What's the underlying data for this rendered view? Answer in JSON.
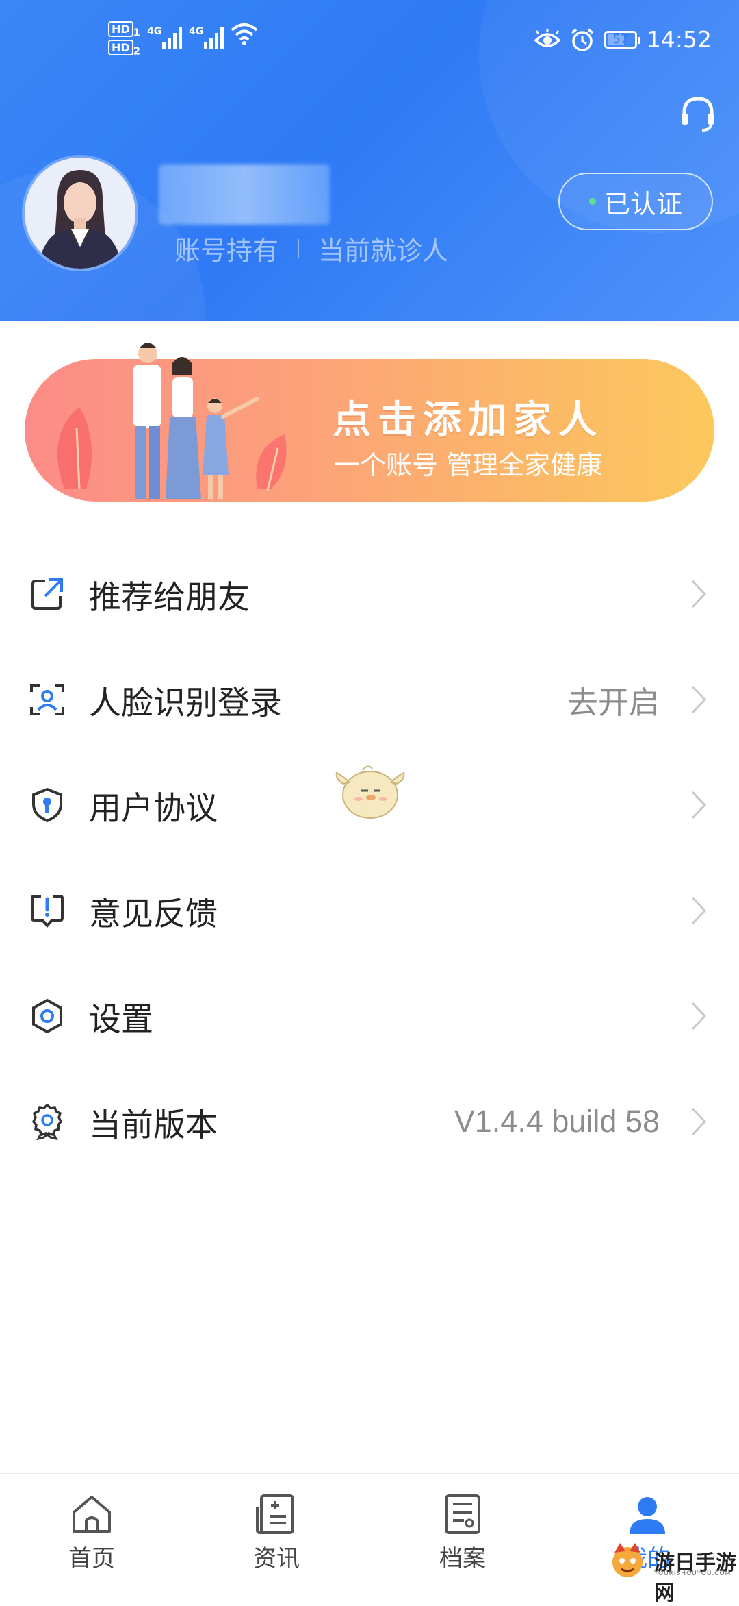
{
  "status_bar": {
    "hd1": "HD",
    "hd1_sub": "1",
    "hd2": "HD",
    "hd2_sub": "2",
    "net1": "4G",
    "net2": "4G",
    "battery": "57",
    "time": "14:52"
  },
  "profile": {
    "tag_holder": "账号持有",
    "tag_patient": "当前就诊人",
    "verified_label": "已认证"
  },
  "banner": {
    "title": "点击添加家人",
    "subtitle": "一个账号 管理全家健康"
  },
  "menu": {
    "items": [
      {
        "label": "推荐给朋友",
        "value": "",
        "icon": "share-icon"
      },
      {
        "label": "人脸识别登录",
        "value": "去开启",
        "icon": "face-id-icon"
      },
      {
        "label": "用户协议",
        "value": "",
        "icon": "shield-lock-icon"
      },
      {
        "label": "意见反馈",
        "value": "",
        "icon": "feedback-icon"
      },
      {
        "label": "设置",
        "value": "",
        "icon": "settings-icon"
      },
      {
        "label": "当前版本",
        "value": "V1.4.4 build 58",
        "icon": "badge-icon"
      }
    ]
  },
  "tabbar": {
    "tabs": [
      {
        "label": "首页",
        "icon": "home-icon"
      },
      {
        "label": "资讯",
        "icon": "news-icon"
      },
      {
        "label": "档案",
        "icon": "records-icon"
      },
      {
        "label": "我的",
        "icon": "profile-icon"
      }
    ],
    "active_index": 3
  },
  "watermark": {
    "text": "游日手游网",
    "sub": "YOURISHOUYOU.COM"
  },
  "colors": {
    "primary": "#2f7af5",
    "banner_start": "#fc8c87",
    "banner_end": "#fcc95e",
    "chevron": "#c8c8c8",
    "value_text": "#8c8c8c"
  }
}
